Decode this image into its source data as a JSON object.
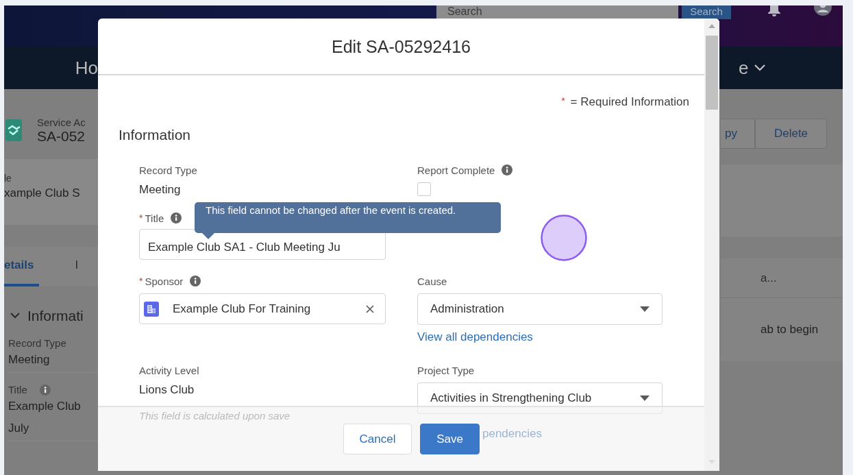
{
  "background_app": {
    "search_field": {
      "placeholder": "Search"
    },
    "search_button": "Search",
    "nav_left": "Ho",
    "nav_right": "e",
    "record": {
      "object_label": "Service Ac",
      "name": "SA-052"
    },
    "highlight": {
      "label": "le",
      "value": "xample Club S"
    },
    "actions": [
      "py",
      "Delete"
    ],
    "tabs": [
      {
        "label": "etails",
        "selected": true
      },
      {
        "label": "I",
        "selected": false
      }
    ],
    "right_tab": "a...",
    "right_message": "ab to begin",
    "section": {
      "title": "Informati",
      "expanded": true
    },
    "fields": [
      {
        "label": "Record Type",
        "info": false,
        "lines": [
          "Meeting"
        ]
      },
      {
        "label": "Title",
        "info": true,
        "lines": [
          "Example Club",
          "July"
        ]
      }
    ]
  },
  "modal": {
    "title": "Edit SA-05292416",
    "required_note": {
      "mark": "*",
      "text": "= Required Information"
    },
    "section_title": "Information",
    "rows": [
      {
        "left": {
          "kind": "readonly",
          "label": "Record Type",
          "info": false,
          "value": "Meeting"
        },
        "right": {
          "kind": "checkbox",
          "label": "Report Complete",
          "info": true,
          "checked": false
        }
      },
      {
        "left": {
          "kind": "text",
          "label": "Title",
          "required_mark": "*",
          "info": true,
          "value": "Example Club SA1 - Club Meeting Ju"
        }
      },
      {
        "left": {
          "kind": "lookup",
          "label": "Sponsor",
          "required_mark": "*",
          "info": true,
          "value": "Example Club For Training"
        },
        "right": {
          "kind": "picklist",
          "label": "Cause",
          "info": false,
          "value": "Administration",
          "link": "View all dependencies"
        }
      },
      {
        "left": {
          "kind": "readonly",
          "label": "Activity Level",
          "info": false,
          "value": "Lions Club",
          "help": "This field is calculated upon save"
        },
        "right": {
          "kind": "picklist",
          "label": "Project Type",
          "info": false,
          "value": "Activities in Strengthening Club",
          "link": "pendencies",
          "link_covered": true
        }
      }
    ],
    "tooltip": "This field cannot be changed after the event is created.",
    "buttons": [
      {
        "label": "Cancel",
        "kind": "neutral"
      },
      {
        "label": "Save",
        "kind": "brand"
      }
    ]
  }
}
